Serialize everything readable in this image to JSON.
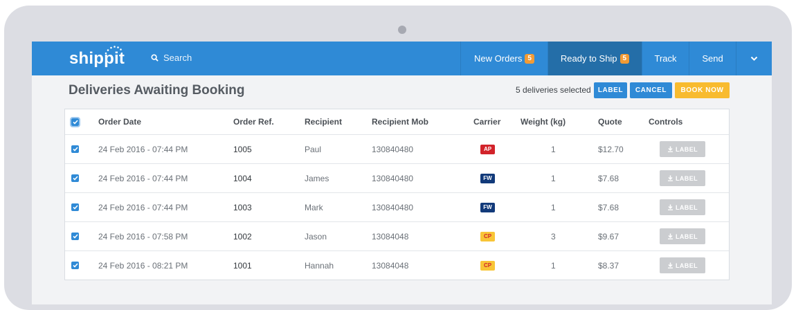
{
  "nav": {
    "logo_text": "shippit",
    "search_placeholder": "Search",
    "tabs": [
      {
        "label": "New Orders",
        "badge": "5"
      },
      {
        "label": "Ready to Ship",
        "badge": "5"
      },
      {
        "label": "Track"
      },
      {
        "label": "Send"
      }
    ],
    "more_icon": "chevron-down-icon"
  },
  "header": {
    "title": "Deliveries Awaiting Booking",
    "selected_text": "5 deliveries selected",
    "buttons": {
      "label": "LABEL",
      "cancel": "CANCEL",
      "book": "BOOK NOW"
    }
  },
  "colors": {
    "nav_bg": "#2f8ad6",
    "label_btn": "#2f8ad6",
    "cancel_btn": "#2f8ad6",
    "book_btn": "#f8bb2f",
    "badge": "#f29b35"
  },
  "table": {
    "columns": [
      "Order Date",
      "Order Ref.",
      "Recipient",
      "Recipient Mob",
      "Carrier",
      "Weight (kg)",
      "Quote",
      "Controls"
    ],
    "row_action_label": "LABEL",
    "rows": [
      {
        "date": "24 Feb 2016 - 07:44 PM",
        "ref": "1005",
        "recipient": "Paul",
        "mobile": "130840480",
        "carrier": "AP",
        "weight": "1",
        "quote": "$12.70"
      },
      {
        "date": "24 Feb 2016 - 07:44 PM",
        "ref": "1004",
        "recipient": "James",
        "mobile": "130840480",
        "carrier": "FW",
        "weight": "1",
        "quote": "$7.68"
      },
      {
        "date": "24 Feb 2016 - 07:44 PM",
        "ref": "1003",
        "recipient": "Mark",
        "mobile": "130840480",
        "carrier": "FW",
        "weight": "1",
        "quote": "$7.68"
      },
      {
        "date": "24 Feb 2016 - 07:58 PM",
        "ref": "1002",
        "recipient": "Jason",
        "mobile": "13084048",
        "carrier": "CP",
        "weight": "3",
        "quote": "$9.67"
      },
      {
        "date": "24 Feb 2016 - 08:21 PM",
        "ref": "1001",
        "recipient": "Hannah",
        "mobile": "13084048",
        "carrier": "CP",
        "weight": "1",
        "quote": "$8.37"
      }
    ],
    "carrier_colors": {
      "AP": {
        "bg": "#d2232a",
        "fg": "#ffffff"
      },
      "FW": {
        "bg": "#123a7a",
        "fg": "#ffffff"
      },
      "CP": {
        "bg": "#f8c537",
        "fg": "#d2232a"
      }
    }
  }
}
